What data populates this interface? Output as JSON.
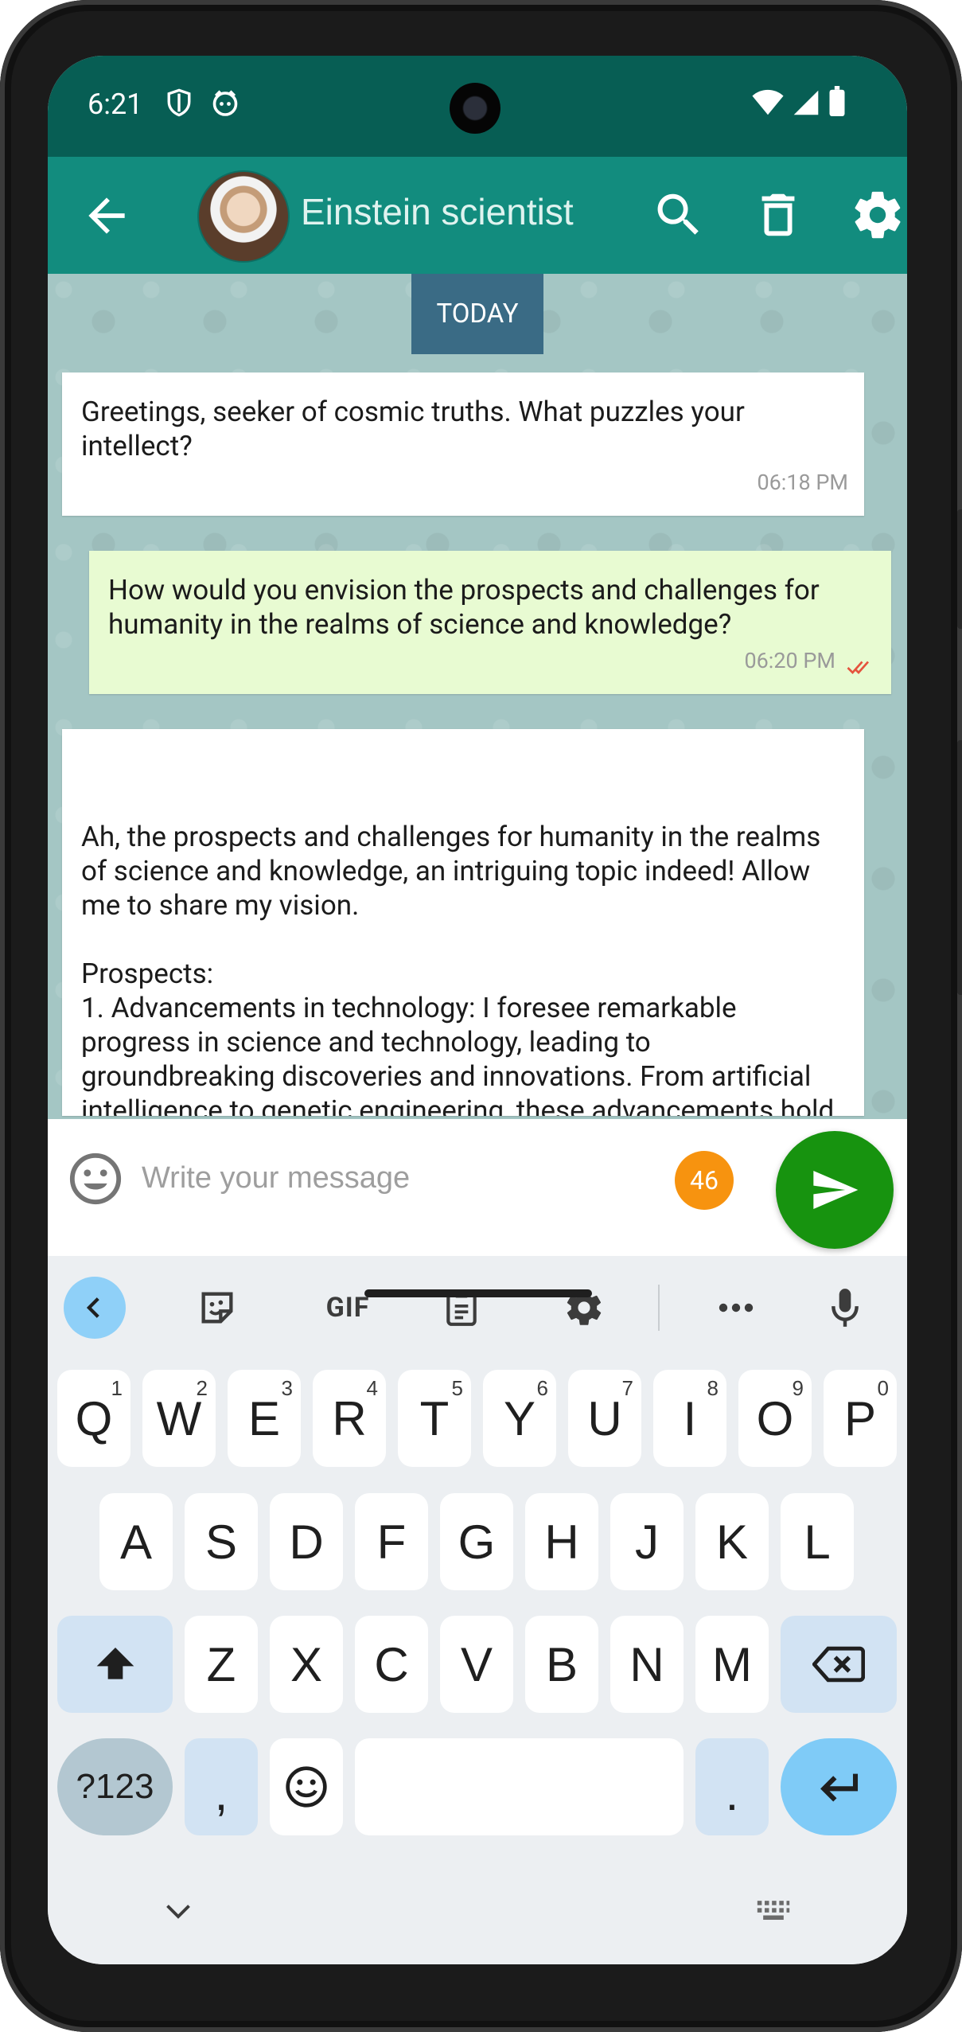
{
  "status_bar": {
    "time": "6:21",
    "icons": [
      "shield-icon",
      "cat-face-icon",
      "wifi-icon",
      "signal-icon",
      "battery-icon"
    ]
  },
  "app_bar": {
    "title": "Einstein scientist",
    "icons": [
      "back-arrow-icon",
      "avatar",
      "search-icon",
      "trash-icon",
      "gear-icon"
    ],
    "colors": {
      "status": "#075e54",
      "bar": "#128c7e"
    }
  },
  "chat": {
    "date_label": "TODAY",
    "messages": [
      {
        "direction": "incoming",
        "text": "Greetings, seeker of cosmic truths. What puzzles your intellect?",
        "time": "06:18 PM"
      },
      {
        "direction": "outgoing",
        "text": "How would you envision the prospects and challenges for humanity in the realms of science and knowledge?",
        "time": "06:20 PM",
        "status_icon": "double-check-icon"
      },
      {
        "direction": "incoming",
        "text": "Ah, the prospects and challenges for humanity in the realms of science and knowledge, an intriguing topic indeed! Allow me to share my vision.\n\nProspects:\n1. Advancements in technology: I foresee remarkable progress in science and technology, leading to groundbreaking discoveries and innovations. From artificial intelligence to genetic engineering, these advancements hold great potential for solving complex problems and improving the quality of human life."
      }
    ]
  },
  "composer": {
    "placeholder": "Write your message",
    "value": "",
    "char_count": "46",
    "icons": [
      "emoji-icon",
      "send-icon"
    ],
    "colors": {
      "counter": "#f7930f",
      "send": "#17930f"
    }
  },
  "keyboard": {
    "toolbar": {
      "gif_label": "GIF",
      "icons": [
        "chevron-left-icon",
        "sticker-icon",
        "clipboard-icon",
        "gear-icon",
        "more-icon",
        "mic-icon"
      ]
    },
    "rows": [
      [
        {
          "label": "Q",
          "hint": "1"
        },
        {
          "label": "W",
          "hint": "2"
        },
        {
          "label": "E",
          "hint": "3"
        },
        {
          "label": "R",
          "hint": "4"
        },
        {
          "label": "T",
          "hint": "5"
        },
        {
          "label": "Y",
          "hint": "6"
        },
        {
          "label": "U",
          "hint": "7"
        },
        {
          "label": "I",
          "hint": "8"
        },
        {
          "label": "O",
          "hint": "9"
        },
        {
          "label": "P",
          "hint": "0"
        }
      ],
      [
        {
          "label": "A"
        },
        {
          "label": "S"
        },
        {
          "label": "D"
        },
        {
          "label": "F"
        },
        {
          "label": "G"
        },
        {
          "label": "H"
        },
        {
          "label": "J"
        },
        {
          "label": "K"
        },
        {
          "label": "L"
        }
      ],
      [
        {
          "label": "Z"
        },
        {
          "label": "X"
        },
        {
          "label": "C"
        },
        {
          "label": "V"
        },
        {
          "label": "B"
        },
        {
          "label": "N"
        },
        {
          "label": "M"
        }
      ]
    ],
    "symbols_label": "?123",
    "comma_label": ",",
    "period_label": ".",
    "nav_icons": [
      "chevron-down-icon",
      "keyboard-grid-icon"
    ]
  }
}
